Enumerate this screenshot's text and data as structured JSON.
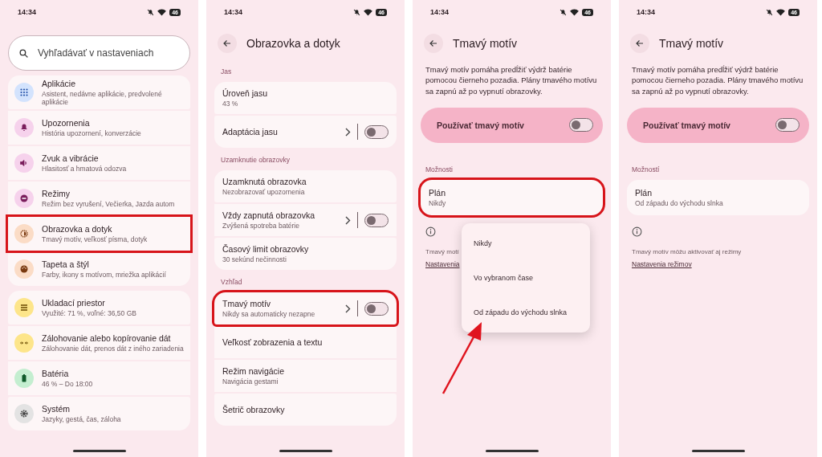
{
  "screens": [
    {
      "kind": "settings_home",
      "status": {
        "time": "14:34",
        "battery": "46"
      },
      "search": {
        "placeholder": "Vyhľadávať v nastaveniach"
      },
      "groups": [
        {
          "items": [
            {
              "kind": "grid",
              "color": "#d3e3fd",
              "title": "Aplikácie",
              "subtitle": "Asistent, nedávne aplikácie, predvolené aplikácie",
              "highlighted": false
            },
            {
              "kind": "bell",
              "color": "#f6d2ec",
              "title": "Upozornenia",
              "subtitle": "História upozornení, konverzácie",
              "highlighted": false
            },
            {
              "kind": "speaker",
              "color": "#f6d2ec",
              "title": "Zvuk a vibrácie",
              "subtitle": "Hlasitosť a hmatová odozva",
              "highlighted": false
            },
            {
              "kind": "minus",
              "color": "#f6d2ec",
              "title": "Režimy",
              "subtitle": "Režim bez vyrušení, Večierka, Jazda autom",
              "highlighted": false
            },
            {
              "kind": "brightness",
              "color": "#fbdcc6",
              "title": "Obrazovka a dotyk",
              "subtitle": "Tmavý motív, veľkosť písma, dotyk",
              "highlighted": true
            },
            {
              "kind": "palette",
              "color": "#fbdcc6",
              "title": "Tapeta a štýl",
              "subtitle": "Farby, ikony s motívom, mriežka aplikácií",
              "highlighted": false
            }
          ]
        },
        {
          "items": [
            {
              "kind": "list",
              "color": "#fde58a",
              "title": "Ukladací priestor",
              "subtitle": "Využité: 71 %, voľné: 36,50 GB",
              "highlighted": false
            },
            {
              "kind": "arrows",
              "color": "#fde58a",
              "title": "Zálohovanie alebo kopírovanie dát",
              "subtitle": "Zálohovanie dát, prenos dát z iného zariadenia",
              "highlighted": false
            },
            {
              "kind": "battery",
              "color": "#c4eed0",
              "title": "Batéria",
              "subtitle": "46 % – Do 18:00",
              "highlighted": false
            },
            {
              "kind": "gear",
              "color": "#e3e3e3",
              "title": "Systém",
              "subtitle": "Jazyky, gestá, čas, záloha",
              "highlighted": false
            }
          ]
        }
      ]
    },
    {
      "kind": "settings_detail",
      "status": {
        "time": "14:34",
        "battery": "46"
      },
      "title": "Obrazovka a dotyk",
      "sections": [
        {
          "heading": "Jas",
          "items": [
            {
              "kind": "plain",
              "title": "Úroveň jasu",
              "subtitle": "43 %",
              "highlighted": false
            },
            {
              "kind": "switch",
              "title": "Adaptácia jasu",
              "on": false,
              "highlighted": false
            }
          ]
        },
        {
          "heading": "Uzamknutie obrazovky",
          "items": [
            {
              "kind": "plain",
              "title": "Uzamknutá obrazovka",
              "subtitle": "Nezobrazovať upozornenia",
              "highlighted": false
            },
            {
              "kind": "switch",
              "title": "Vždy zapnutá obrazovka",
              "subtitle": "Zvýšená spotreba batérie",
              "on": false,
              "highlighted": false
            },
            {
              "kind": "plain",
              "title": "Časový limit obrazovky",
              "subtitle": "30 sekúnd nečinnosti",
              "highlighted": false
            }
          ]
        },
        {
          "heading": "Vzhľad",
          "items": [
            {
              "kind": "switch",
              "title": "Tmavý motív",
              "subtitle": "Nikdy sa automaticky nezapne",
              "on": false,
              "highlighted": true
            },
            {
              "kind": "plain",
              "title": "Veľkosť zobrazenia a textu",
              "highlighted": false
            },
            {
              "kind": "plain",
              "title": "Režim navigácie",
              "subtitle": "Navigácia gestami",
              "highlighted": false
            },
            {
              "kind": "plain",
              "title": "Šetrič obrazovky",
              "highlighted": false
            }
          ]
        }
      ]
    },
    {
      "kind": "dark_theme",
      "status": {
        "time": "14:34",
        "battery": "46"
      },
      "title": "Tmavý motív",
      "description": "Tmavý motív pomáha predĺžiť výdrž batérie pomocou čierneho pozadia. Plány tmavého motívu sa zapnú až po vypnutí obrazovky.",
      "main_switch": {
        "label": "Používať tmavý motív",
        "on": false
      },
      "section": "Možnosti",
      "plan": {
        "title": "Plán",
        "value": "Nikdy",
        "highlighted": true
      },
      "note": "Tmavý motí",
      "link": "Nastavenia",
      "menu": {
        "options": [
          "Nikdy",
          "Vo vybranom čase",
          "Od západu do východu slnka"
        ]
      }
    },
    {
      "kind": "dark_theme",
      "status": {
        "time": "14:34",
        "battery": "46"
      },
      "title": "Tmavý motív",
      "description": "Tmavý motív pomáha predĺžiť výdrž batérie pomocou čierneho pozadia. Plány tmavého motívu sa zapnú až po vypnutí obrazovky.",
      "main_switch": {
        "label": "Používať tmavý motív",
        "on": false
      },
      "section": "Možností",
      "plan": {
        "title": "Plán",
        "value": "Od západu do východu slnka",
        "highlighted": false
      },
      "note": "Tmavý motív môžu aktivovať aj režimy",
      "link": "Nastavenia režimov"
    }
  ]
}
